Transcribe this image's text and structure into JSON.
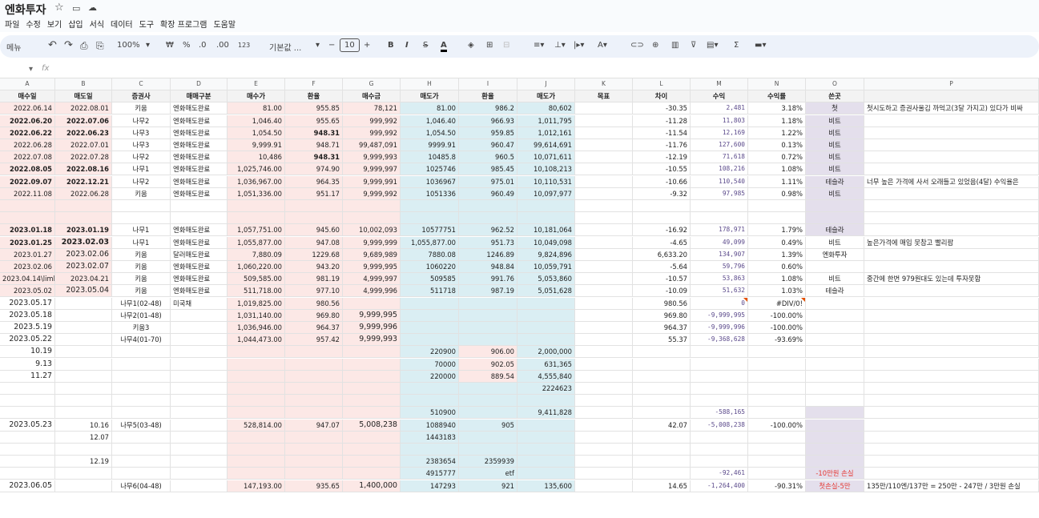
{
  "doc": {
    "title": "엔화투자",
    "icons": [
      "star-icon",
      "folder-icon",
      "cloud-icon"
    ]
  },
  "menu": [
    "파일",
    "수정",
    "보기",
    "삽입",
    "서식",
    "데이터",
    "도구",
    "확장 프로그램",
    "도움말"
  ],
  "toolbar": {
    "search": "메뉴",
    "undo": "↶",
    "redo": "↷",
    "print": "⎙",
    "paint": "⎘",
    "zoom": "100%",
    "zoom_arrow": "▾",
    "currency": "₩",
    "percent": "%",
    "dec_less": ".0",
    "dec_more": ".00",
    "fmt123": "123",
    "font": "기본값 ...",
    "font_arrow": "▾",
    "minus": "−",
    "font_size": "10",
    "plus": "+",
    "bold": "B",
    "italic": "I",
    "strike": "S",
    "textcolor": "A",
    "fill": "◈",
    "borders": "⊞",
    "merge": "⊟",
    "align": "≡▾",
    "valign": "⊥▾",
    "wrap": "|▸▾",
    "rotate": "A▾",
    "link": "⊂⊃",
    "comment": "⊕",
    "chart": "▥",
    "filter": "⊽",
    "filterview": "▤▾",
    "sum": "Σ",
    "more": "▬▾"
  },
  "formula": {
    "ref": "▾",
    "fx": "fx",
    "value": ""
  },
  "columns": [
    "A",
    "B",
    "C",
    "D",
    "E",
    "F",
    "G",
    "H",
    "I",
    "J",
    "K",
    "L",
    "M",
    "N",
    "O",
    "P"
  ],
  "header": [
    "매수일",
    "매도일",
    "증권사",
    "매매구분",
    "매수가",
    "환율",
    "매수금",
    "매도가",
    "환율",
    "매도가",
    "목표",
    "차이",
    "수익",
    "수익률",
    "쓴곳",
    "P"
  ],
  "rows": [
    [
      "2022.06.14",
      "2022.08.01",
      "키움",
      "엔화매도완료",
      "81.00",
      "955.85",
      "78,121",
      "81.00",
      "986.2",
      "80,602",
      "",
      "-30.35",
      "2,481",
      "3.18%",
      "첫",
      "첫시도하고 증권사울김 까먹고(3달 가지고) 있다가 비싸"
    ],
    [
      "2022.06.20",
      "2022.07.06",
      "나무2",
      "엔화매도완료",
      "1,046.40",
      "955.65",
      "999,992",
      "1,046.40",
      "966.93",
      "1,011,795",
      "",
      "-11.28",
      "11,803",
      "1.18%",
      "비트",
      ""
    ],
    [
      "2022.06.22",
      "2022.06.23",
      "나무3",
      "엔화매도완료",
      "1,054.50",
      "948.31",
      "999,992",
      "1,054.50",
      "959.85",
      "1,012,161",
      "",
      "-11.54",
      "12,169",
      "1.22%",
      "비트",
      ""
    ],
    [
      "2022.06.28",
      "2022.07.01",
      "나무3",
      "엔화매도완료",
      "9,999.91",
      "948.71",
      "99,487,091",
      "9999.91",
      "960.47",
      "99,614,691",
      "",
      "-11.76",
      "127,600",
      "0.13%",
      "비트",
      ""
    ],
    [
      "2022.07.08",
      "2022.07.28",
      "나무2",
      "엔화매도완료",
      "10,486",
      "948.31",
      "9,999,993",
      "10485.8",
      "960.5",
      "10,071,611",
      "",
      "-12.19",
      "71,618",
      "0.72%",
      "비트",
      ""
    ],
    [
      "2022.08.05",
      "2022.08.16",
      "나무1",
      "엔화매도완료",
      "1,025,746.00",
      "974.90",
      "9,999,997",
      "1025746",
      "985.45",
      "10,108,213",
      "",
      "-10.55",
      "108,216",
      "1.08%",
      "비트",
      ""
    ],
    [
      "2022.09.07",
      "2022.12.21",
      "나무2",
      "엔화매도완료",
      "1,036,967.00",
      "964.35",
      "9,999,991",
      "1036967",
      "975.01",
      "10,110,531",
      "",
      "-10.66",
      "110,540",
      "1.11%",
      "테슬라",
      "너무 높은 가격에 사서 오래들고 있었음(4달) 수익율은 "
    ],
    [
      "2022.11.08",
      "2022.06.28",
      "키움",
      "엔화매도완료",
      "1,051,336.00",
      "951.17",
      "9,999,992",
      "1051336",
      "960.49",
      "10,097,977",
      "",
      "-9.32",
      "97,985",
      "0.98%",
      "비트",
      ""
    ],
    [
      "",
      "",
      "",
      "",
      "",
      "",
      "",
      "",
      "",
      "",
      "",
      "",
      "",
      "",
      "",
      ""
    ],
    [
      "",
      "",
      "",
      "",
      "",
      "",
      "",
      "",
      "",
      "",
      "",
      "",
      "",
      "",
      "",
      ""
    ],
    [
      "2023.01.18",
      "2023.01.19",
      "나무1",
      "엔화매도완료",
      "1,057,751.00",
      "945.60",
      "10,002,093",
      "10577751",
      "962.52",
      "10,181,064",
      "",
      "-16.92",
      "178,971",
      "1.79%",
      "테슬라",
      ""
    ],
    [
      "2023.01.25",
      "2023.02.03",
      "나무1",
      "엔화매도완료",
      "1,055,877.00",
      "947.08",
      "9,999,999",
      "1,055,877.00",
      "951.73",
      "10,049,098",
      "",
      "-4.65",
      "49,099",
      "0.49%",
      "비트",
      "높은가격에 매입 못참고 빨리팜"
    ],
    [
      "2023.01.27",
      "2023.02.06",
      "키움",
      "달러매도완료",
      "7,880.09",
      "1229.68",
      "9,689,989",
      "7880.08",
      "1246.89",
      "9,824,896",
      "",
      "6,633.20",
      "134,907",
      "1.39%",
      "엔화투자",
      ""
    ],
    [
      "2023.02.06",
      "2023.02.07",
      "키움",
      "엔화매도완료",
      "1,060,220.00",
      "943.20",
      "9,999,995",
      "1060220",
      "948.84",
      "10,059,791",
      "",
      "-5.64",
      "59,796",
      "0.60%",
      "",
      ""
    ],
    [
      "2023.04.14\\limkl",
      "2023.04.21",
      "키움",
      "엔화매도완료",
      "509,585.00",
      "981.19",
      "4,999,997",
      "509585",
      "991.76",
      "5,053,860",
      "",
      "-10.57",
      "53,863",
      "1.08%",
      "비트",
      "중간에 한번 979원대도 있는데 투자못함"
    ],
    [
      "2023.05.02",
      "2023.05.04",
      "키움",
      "엔화매도완료",
      "511,718.00",
      "977.10",
      "4,999,996",
      "511718",
      "987.19",
      "5,051,628",
      "",
      "-10.09",
      "51,632",
      "1.03%",
      "테슬라",
      ""
    ],
    [
      "2023.05.17",
      "",
      "나무1(02-48)",
      "미국채",
      "1,019,825.00",
      "980.56",
      "",
      "",
      "",
      "",
      "",
      "980.56",
      "0",
      "#DIV/0!",
      "",
      ""
    ],
    [
      "2023.05.18",
      "",
      "나무2(01-48)",
      "",
      "1,031,140.00",
      "969.80",
      "9,999,995",
      "",
      "",
      "",
      "",
      "969.80",
      "-9,999,995",
      "-100.00%",
      "",
      ""
    ],
    [
      "2023.5.19",
      "",
      "키움3",
      "",
      "1,036,946.00",
      "964.37",
      "9,999,996",
      "",
      "",
      "",
      "",
      "964.37",
      "-9,999,996",
      "-100.00%",
      "",
      ""
    ],
    [
      "2023.05.22",
      "",
      "나무4(01-70)",
      "",
      "1,044,473.00",
      "957.42",
      "9,999,993",
      "",
      "",
      "",
      "",
      "55.37",
      "-9,368,628",
      "-93.69%",
      "",
      ""
    ],
    [
      "10.19",
      "",
      "",
      "",
      "",
      "",
      "",
      "220900",
      "906.00",
      "2,000,000",
      "",
      "",
      "",
      "",
      "",
      ""
    ],
    [
      "9.13",
      "",
      "",
      "",
      "",
      "",
      "",
      "70000",
      "902.05",
      "631,365",
      "",
      "",
      "",
      "",
      "",
      ""
    ],
    [
      "11.27",
      "",
      "",
      "",
      "",
      "",
      "",
      "220000",
      "889.54",
      "4,555,840",
      "",
      "",
      "",
      "",
      "",
      ""
    ],
    [
      "",
      "",
      "",
      "",
      "",
      "",
      "",
      "",
      "",
      "2224623",
      "",
      "",
      "",
      "",
      "",
      ""
    ],
    [
      "",
      "",
      "",
      "",
      "",
      "",
      "",
      "",
      "",
      "",
      "",
      "",
      "",
      "",
      "",
      ""
    ],
    [
      "",
      "",
      "",
      "",
      "",
      "",
      "",
      "510900",
      "",
      "9,411,828",
      "",
      "",
      "-588,165",
      "",
      "",
      ""
    ],
    [
      "2023.05.23",
      "10.16",
      "나무5(03-48)",
      "",
      "528,814.00",
      "947.07",
      "5,008,238",
      "1088940",
      "905",
      "",
      "",
      "42.07",
      "-5,008,238",
      "-100.00%",
      "",
      ""
    ],
    [
      "",
      "12.07",
      "",
      "",
      "",
      "",
      "",
      "1443183",
      "",
      "",
      "",
      "",
      "",
      "",
      "",
      ""
    ],
    [
      "",
      "",
      "",
      "",
      "",
      "",
      "",
      "",
      "",
      "",
      "",
      "",
      "",
      "",
      "",
      ""
    ],
    [
      "",
      "12.19",
      "",
      "",
      "",
      "",
      "",
      "2383654",
      "2359939",
      "",
      "",
      "",
      "",
      "",
      "",
      ""
    ],
    [
      "",
      "",
      "",
      "",
      "",
      "",
      "",
      "4915777",
      "etf",
      "",
      "",
      "",
      "-92,461",
      "",
      "-10만원 손실",
      ""
    ],
    [
      "2023.06.05",
      "",
      "나무6(04-48)",
      "",
      "147,193.00",
      "935.65",
      "1,400,000",
      "147293",
      "921",
      "135,600",
      "",
      "14.65",
      "-1,264,400",
      "-90.31%",
      "첫손실-5만",
      "135만/110엔/137만 = 250만 - 247만 / 3만원 손실"
    ]
  ],
  "colors": {
    "pink": "#fce8e6",
    "blue": "#daeef3",
    "purple": "#e4dfec",
    "gray": "#f3f3f3",
    "mono_purple": "#5b4a8b",
    "red": "#e53935"
  }
}
